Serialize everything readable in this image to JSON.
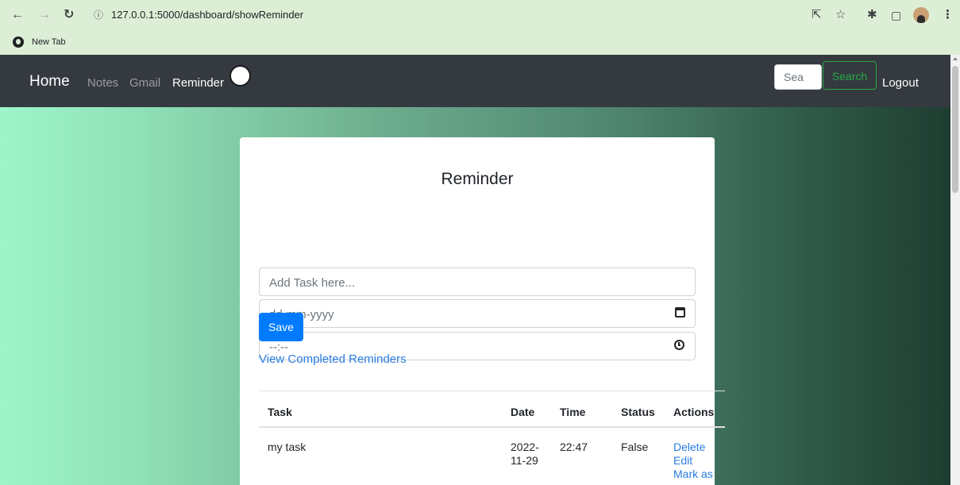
{
  "browser": {
    "url": "127.0.0.1:5000/dashboard/showReminder",
    "bookmark_label": "New Tab",
    "icons": [
      "back-icon",
      "forward-icon",
      "reload-icon",
      "info-icon",
      "share-icon",
      "star-icon",
      "extensions-icon",
      "sidebar-icon",
      "profile-avatar",
      "menu-icon"
    ]
  },
  "navbar": {
    "brand": "Home",
    "links": [
      "Notes",
      "Gmail",
      "Reminder"
    ],
    "active_link": "Reminder",
    "search_placeholder": "Sea",
    "search_button": "Search",
    "logout": "Logout"
  },
  "reminder": {
    "title": "Reminder",
    "task_placeholder": "Add Task here...",
    "date_placeholder": "dd-mm-yyyy",
    "time_placeholder": "--:--",
    "save_label": "Save",
    "view_completed": "View Completed Reminders",
    "table": {
      "headers": [
        "Task",
        "Date",
        "Time",
        "Status",
        "Actions"
      ],
      "rows": [
        {
          "task": "my task",
          "date_line1": "2022-",
          "date_line2": "11-29",
          "time": "22:47",
          "status": "False",
          "actions": [
            "Delete",
            "Edit",
            "Mark as"
          ]
        }
      ]
    }
  },
  "colors": {
    "navbar_bg": "#343a40",
    "primary": "#007bff",
    "success": "#28a745",
    "link": "#2a7de1",
    "chrome_bg": "#dcefd6"
  }
}
